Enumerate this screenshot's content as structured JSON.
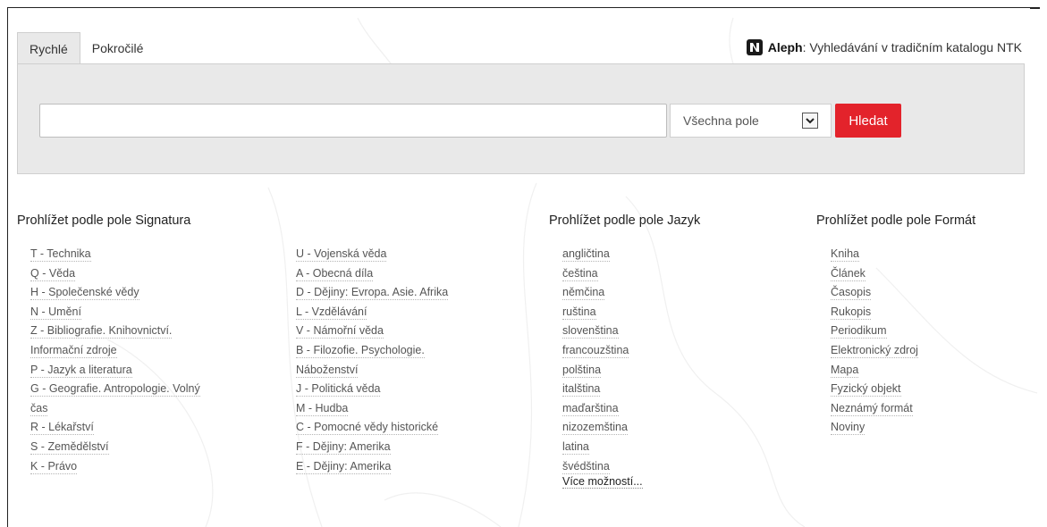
{
  "tabs": {
    "quick": "Rychlé",
    "advanced": "Pokročilé"
  },
  "header": {
    "aleph_brand": "Aleph",
    "aleph_text": ": Vyhledávání v tradičním katalogu NTK"
  },
  "search": {
    "query_value": "",
    "field_select_value": "Všechna pole",
    "submit_label": "Hledat"
  },
  "browse": {
    "signatura": {
      "title": "Prohlížet podle pole Signatura",
      "col1": [
        "T - Technika",
        "Q - Věda",
        "H - Společenské vědy",
        "N - Umění",
        "Z - Bibliografie. Knihovnictví.",
        "Informační zdroje",
        "P - Jazyk a literatura",
        "G - Geografie. Antropologie. Volný",
        "čas",
        "R - Lékařství",
        "S - Zemědělství",
        "K - Právo"
      ],
      "col2": [
        "U - Vojenská věda",
        "A - Obecná díla",
        "D - Dějiny: Evropa. Asie. Afrika",
        "L - Vzdělávání",
        "V - Námořní věda",
        "B - Filozofie. Psychologie.",
        "Náboženství",
        "J - Politická věda",
        "M - Hudba",
        "C - Pomocné vědy historické",
        "F - Dějiny: Amerika",
        "E - Dějiny: Amerika"
      ]
    },
    "jazyk": {
      "title": "Prohlížet podle pole Jazyk",
      "items": [
        "angličtina",
        "čeština",
        "němčina",
        "ruština",
        "slovenština",
        "francouzština",
        "polština",
        "italština",
        "maďarština",
        "nizozemština",
        "latina",
        "švédština"
      ],
      "more": "Více možností..."
    },
    "format": {
      "title": "Prohlížet podle pole Formát",
      "items": [
        "Kniha",
        "Článek",
        "Časopis",
        "Rukopis",
        "Periodikum",
        "Elektronický zdroj",
        "Mapa",
        "Fyzický objekt",
        "Neznámý formát",
        "Noviny"
      ]
    }
  },
  "colors": {
    "accent": "#e3232b",
    "panel": "#e9e9e9"
  },
  "icons": {
    "aleph_logo": "aleph-logo-icon",
    "select_arrow": "chevron-down-icon"
  }
}
